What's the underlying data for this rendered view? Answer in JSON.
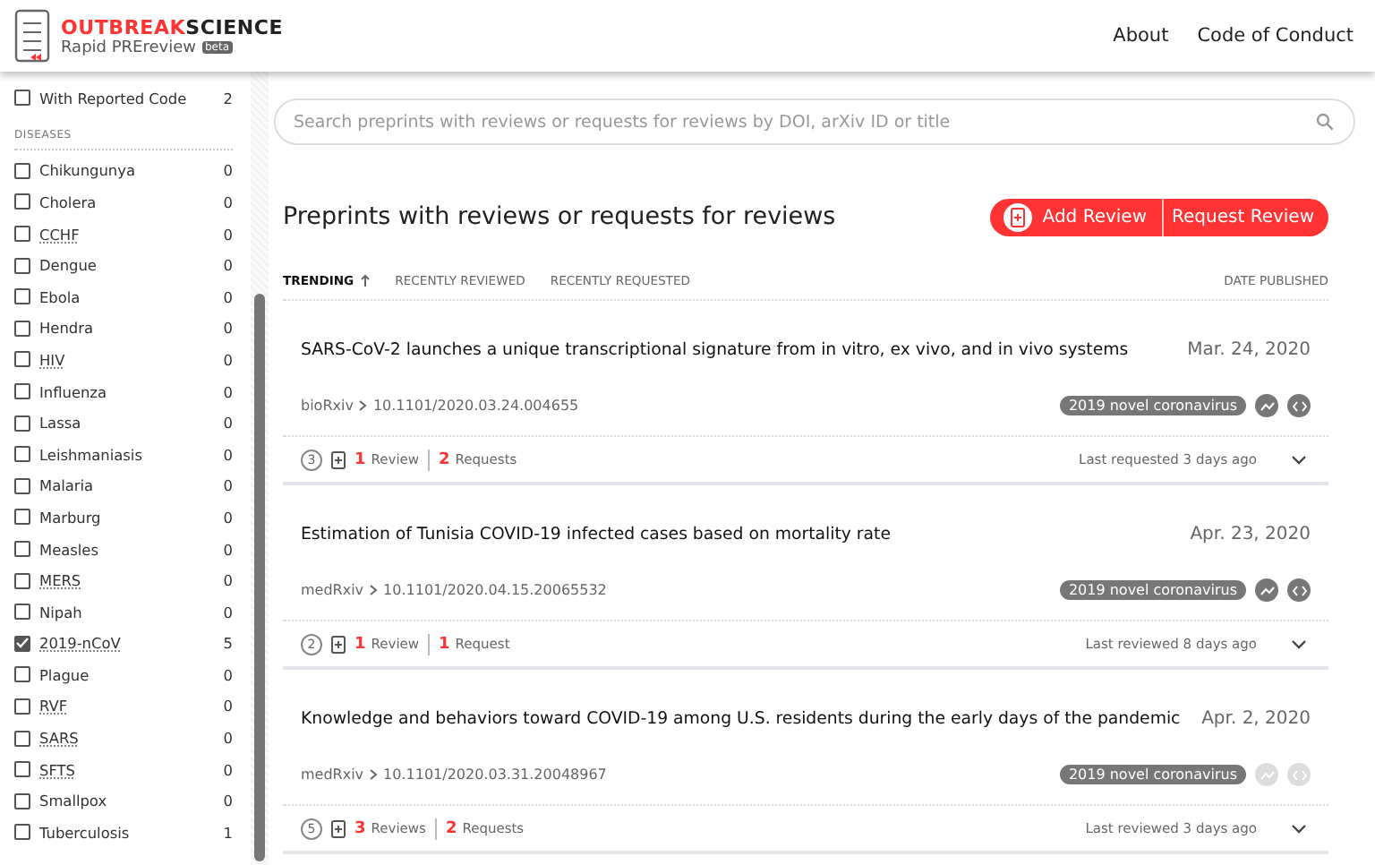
{
  "header": {
    "logo_word_red": "OUTBREAK",
    "logo_word_dark": "SCIENCE",
    "subtitle": "Rapid PREreview",
    "badge": "beta",
    "nav": [
      "About",
      "Code of Conduct"
    ]
  },
  "sidebar": {
    "filters": [
      {
        "label": "With Reported Code",
        "count": "2",
        "checked": false
      }
    ],
    "section": "DISEASES",
    "diseases": [
      {
        "label": "Chikungunya",
        "count": "0",
        "checked": false,
        "abbr": false
      },
      {
        "label": "Cholera",
        "count": "0",
        "checked": false,
        "abbr": false
      },
      {
        "label": "CCHF",
        "count": "0",
        "checked": false,
        "abbr": true
      },
      {
        "label": "Dengue",
        "count": "0",
        "checked": false,
        "abbr": false
      },
      {
        "label": "Ebola",
        "count": "0",
        "checked": false,
        "abbr": false
      },
      {
        "label": "Hendra",
        "count": "0",
        "checked": false,
        "abbr": false
      },
      {
        "label": "HIV",
        "count": "0",
        "checked": false,
        "abbr": true
      },
      {
        "label": "Influenza",
        "count": "0",
        "checked": false,
        "abbr": false
      },
      {
        "label": "Lassa",
        "count": "0",
        "checked": false,
        "abbr": false
      },
      {
        "label": "Leishmaniasis",
        "count": "0",
        "checked": false,
        "abbr": false
      },
      {
        "label": "Malaria",
        "count": "0",
        "checked": false,
        "abbr": false
      },
      {
        "label": "Marburg",
        "count": "0",
        "checked": false,
        "abbr": false
      },
      {
        "label": "Measles",
        "count": "0",
        "checked": false,
        "abbr": false
      },
      {
        "label": "MERS",
        "count": "0",
        "checked": false,
        "abbr": true
      },
      {
        "label": "Nipah",
        "count": "0",
        "checked": false,
        "abbr": false
      },
      {
        "label": "2019-nCoV",
        "count": "5",
        "checked": true,
        "abbr": true
      },
      {
        "label": "Plague",
        "count": "0",
        "checked": false,
        "abbr": false
      },
      {
        "label": "RVF",
        "count": "0",
        "checked": false,
        "abbr": true
      },
      {
        "label": "SARS",
        "count": "0",
        "checked": false,
        "abbr": true
      },
      {
        "label": "SFTS",
        "count": "0",
        "checked": false,
        "abbr": true
      },
      {
        "label": "Smallpox",
        "count": "0",
        "checked": false,
        "abbr": false
      },
      {
        "label": "Tuberculosis",
        "count": "1",
        "checked": false,
        "abbr": false
      }
    ]
  },
  "search": {
    "placeholder": "Search preprints with reviews or requests for reviews by DOI, arXiv ID or title"
  },
  "list_title": "Preprints with reviews or requests for reviews",
  "actions": [
    "Add Review",
    "Request Review"
  ],
  "sort": [
    {
      "label": "TRENDING",
      "selected": true
    },
    {
      "label": "RECENTLY REVIEWED",
      "selected": false
    },
    {
      "label": "RECENTLY REQUESTED",
      "selected": false
    }
  ],
  "sort_right": "DATE PUBLISHED",
  "preprints": [
    {
      "title": "SARS-CoV-2 launches a unique transcriptional signature from in vitro, ex vivo, and in vivo systems",
      "date": "Mar. 24, 2020",
      "server": "bioRxiv",
      "doi": "10.1101/2020.03.24.004655",
      "tag": "2019 novel coronavirus",
      "data_active": true,
      "code_active": true,
      "total": "3",
      "reviews_n": "1",
      "reviews_label": "Review",
      "requests_n": "2",
      "requests_label": "Requests",
      "activity": "Last requested 3 days ago"
    },
    {
      "title": "Estimation of Tunisia COVID-19 infected cases based on mortality rate",
      "date": "Apr. 23, 2020",
      "server": "medRxiv",
      "doi": "10.1101/2020.04.15.20065532",
      "tag": "2019 novel coronavirus",
      "data_active": true,
      "code_active": true,
      "total": "2",
      "reviews_n": "1",
      "reviews_label": "Review",
      "requests_n": "1",
      "requests_label": "Request",
      "activity": "Last reviewed 8 days ago"
    },
    {
      "title": "Knowledge and behaviors toward COVID-19 among U.S. residents during the early days of the pandemic",
      "date": "Apr. 2, 2020",
      "server": "medRxiv",
      "doi": "10.1101/2020.03.31.20048967",
      "tag": "2019 novel coronavirus",
      "data_active": false,
      "code_active": false,
      "total": "5",
      "reviews_n": "3",
      "reviews_label": "Reviews",
      "requests_n": "2",
      "requests_label": "Requests",
      "activity": "Last reviewed 3 days ago"
    }
  ]
}
